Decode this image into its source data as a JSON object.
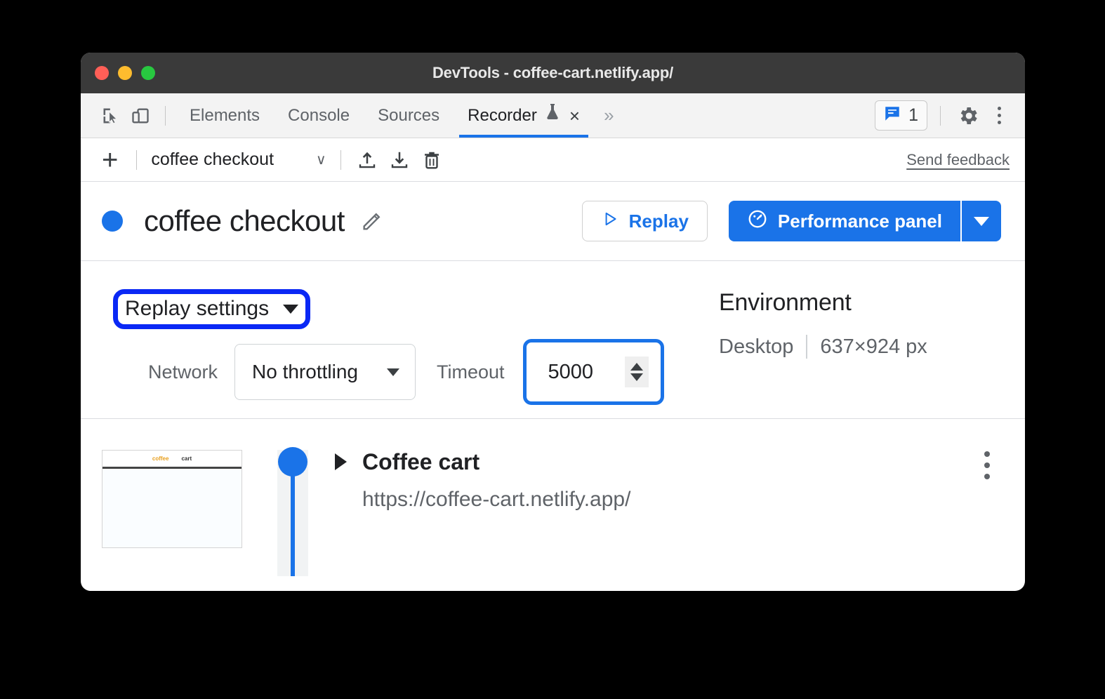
{
  "window": {
    "title": "DevTools - coffee-cart.netlify.app/",
    "traffic_lights": [
      "close",
      "minimize",
      "maximize"
    ]
  },
  "tabbar": {
    "icons": [
      {
        "name": "inspect-element-icon",
        "label": "Inspect element"
      },
      {
        "name": "device-toolbar-icon",
        "label": "Toggle device toolbar"
      }
    ],
    "tabs": [
      {
        "label": "Elements",
        "active": false
      },
      {
        "label": "Console",
        "active": false
      },
      {
        "label": "Sources",
        "active": false
      },
      {
        "label": "Recorder",
        "active": true,
        "experimental": true,
        "closable": true
      }
    ],
    "overflow_label": "»",
    "close_label": "×",
    "issues": {
      "count": "1",
      "icon": "issues-message-icon"
    },
    "settings_icon": "gear-icon",
    "more_icon": "kebab-menu-icon"
  },
  "recorder_toolbar": {
    "add_label": "+",
    "recording_name": "coffee checkout",
    "select_chevron": "∨",
    "export_icon": "upload-icon",
    "import_icon": "download-icon",
    "delete_icon": "trash-icon",
    "feedback_label": "Send feedback"
  },
  "recording_header": {
    "status_dot_color": "#1a73e8",
    "title": "coffee checkout",
    "edit_icon": "pencil-icon",
    "replay_button": {
      "label": "Replay",
      "icon": "play-triangle-icon"
    },
    "performance_button": {
      "label": "Performance panel",
      "icon": "performance-gauge-icon"
    },
    "performance_caret": "caret-down-icon"
  },
  "replay_settings": {
    "toggle_label": "Replay settings",
    "toggle_highlight_color": "#0a28f5",
    "network_label": "Network",
    "network_value": "No throttling",
    "timeout_label": "Timeout",
    "timeout_value": "5000",
    "timeout_highlight_color": "#1a73e8"
  },
  "environment": {
    "title": "Environment",
    "device": "Desktop",
    "viewport": "637×924 px"
  },
  "steps": [
    {
      "title": "Coffee cart",
      "url": "https://coffee-cart.netlify.app/",
      "thumbnail": {
        "logo": "coffee",
        "text": "cart"
      },
      "marker_color": "#1a73e8",
      "menu_icon": "kebab-menu-icon",
      "expand_icon": "triangle-right-icon"
    }
  ]
}
